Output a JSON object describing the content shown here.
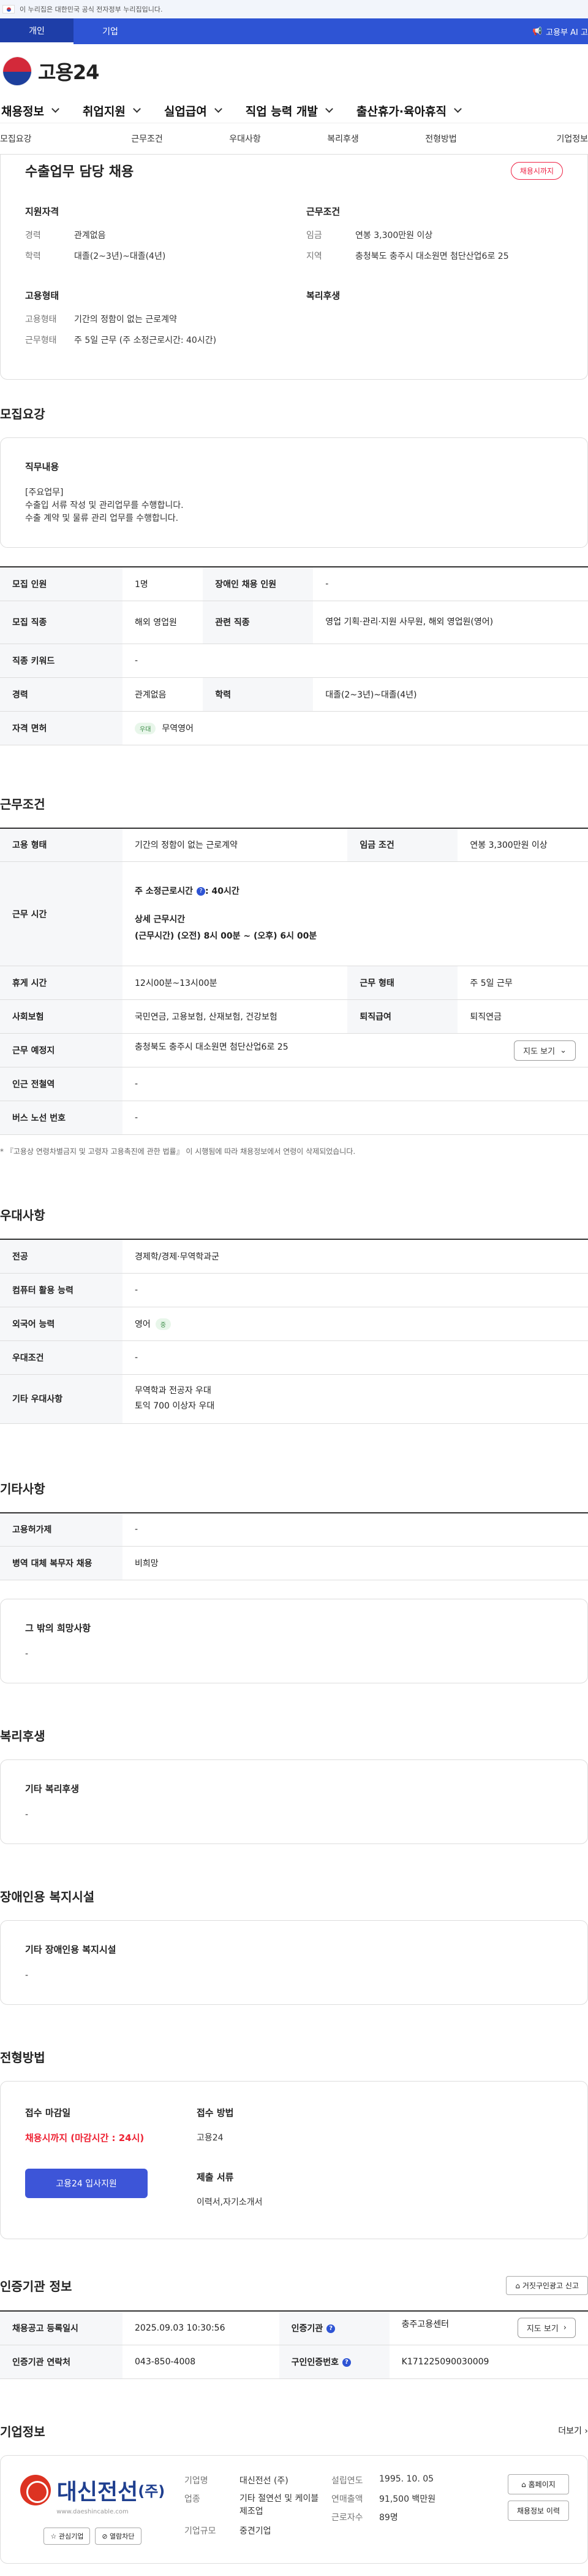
{
  "gov_banner": "이 누리집은 대한민국 공식 전자정부 누리집입니다.",
  "top_tabs": [
    {
      "label": "개인"
    },
    {
      "label": "기업"
    }
  ],
  "top_right": "고용부 AI 고",
  "logo": "고용24",
  "gnb": [
    {
      "label": "채용정보"
    },
    {
      "label": "취업지원"
    },
    {
      "label": "실업급여"
    },
    {
      "label": "직업 능력 개발"
    },
    {
      "label": "출산휴가·육아휴직"
    }
  ],
  "sub_tabs": [
    {
      "label": "모집요강"
    },
    {
      "label": "근무조건"
    },
    {
      "label": "우대사항"
    },
    {
      "label": "복리후생"
    },
    {
      "label": "전형방법"
    },
    {
      "label": "기업정보"
    }
  ],
  "hero": {
    "title": "수출업무 담당 채용",
    "badge": "채용시까지",
    "qualification": {
      "heading": "지원자격",
      "rows": [
        {
          "k": "경력",
          "v": "관계없음"
        },
        {
          "k": "학력",
          "v": "대졸(2~3년)~대졸(4년)"
        }
      ]
    },
    "conditions": {
      "heading": "근무조건",
      "rows": [
        {
          "k": "임금",
          "v": "연봉 3,300만원 이상"
        },
        {
          "k": "지역",
          "v": "충청북도 충주시 대소원면 첨단산업6로 25"
        }
      ]
    },
    "employment": {
      "heading": "고용형태",
      "rows": [
        {
          "k": "고용형태",
          "v": "기간의 정함이 없는 근로계약"
        },
        {
          "k": "근무형태",
          "v": "주 5일 근무 (주 소정근로시간: 40시간)"
        }
      ]
    },
    "welfare": {
      "heading": "복리후생"
    }
  },
  "recruit": {
    "title": "모집요강",
    "duty_heading": "직무내용",
    "duty_lines": [
      "[주요업무]",
      "수출입 서류 작성 및 관리업무를 수행합니다.",
      "수출 계약 및 물류 관리 업무를 수행합니다."
    ],
    "rows": [
      {
        "k1": "모집 인원",
        "v1": "1명",
        "k2": "장애인 채용 인원",
        "v2": "-"
      },
      {
        "k1": "모집 직종",
        "v1": "해외 영업원",
        "k2": "관련 직종",
        "v2": "영업 기획·관리·지원 사무원, 해외 영업원(영어)"
      },
      {
        "k1": "직종 키워드",
        "v1": "-"
      },
      {
        "k1": "경력",
        "v1": "관계없음",
        "k2": "학력",
        "v2": "대졸(2~3년)~대졸(4년)"
      },
      {
        "k1": "자격 면허",
        "badge": "우대",
        "v1": "무역영어"
      }
    ]
  },
  "work": {
    "title": "근무조건",
    "employment_type_k": "고용 형태",
    "employment_type_v": "기간의 정함이 없는 근로계약",
    "wage_k": "임금 조건",
    "wage_v": "연봉 3,300만원 이상",
    "hours_k": "근무 시간",
    "hours_main": "주 소정근로시간",
    "hours_main_v": ": 40시간",
    "hours_detail_title": "상세 근무시간",
    "hours_detail": "(근무시간) (오전) 8시 00분 ~ (오후) 6시 00분",
    "break_k": "휴게 시간",
    "break_v": "12시00분~13시00분",
    "shift_k": "근무 형태",
    "shift_v": "주 5일 근무",
    "insurance_k": "사회보험",
    "insurance_v": "국민연금, 고용보험, 산재보험, 건강보험",
    "severance_k": "퇴직급여",
    "severance_v": "퇴직연금",
    "place_k": "근무 예정지",
    "place_v": "충청북도 충주시 대소원면 첨단산업6로 25",
    "map_btn": "지도 보기",
    "subway_k": "인근 전철역",
    "subway_v": "-",
    "bus_k": "버스 노선 번호",
    "bus_v": "-",
    "note": "* 『고용상 연령차별금지 및 고령자 고용촉진에 관한 법률』 이 시행됨에 따라 채용정보에서 연령이 삭제되었습니다."
  },
  "prefer": {
    "title": "우대사항",
    "rows": [
      {
        "k": "전공",
        "v": "경제학/경제·무역학과군"
      },
      {
        "k": "컴퓨터 활용 능력",
        "v": "-"
      },
      {
        "k": "외국어 능력",
        "v": "영어",
        "badge": "중"
      },
      {
        "k": "우대조건",
        "v": "-"
      },
      {
        "k": "기타 우대사항",
        "lines": [
          "무역학과 전공자 우대",
          "토익 700 이상자 우대"
        ]
      }
    ]
  },
  "etc": {
    "title": "기타사항",
    "rows": [
      {
        "k": "고용허가제",
        "v": "-"
      },
      {
        "k": "병역 대체 복무자 채용",
        "v": "비희망"
      }
    ],
    "other_heading": "그 밖의 희망사항",
    "other_v": "-"
  },
  "welfare": {
    "title": "복리후생",
    "heading": "기타 복리후생",
    "v": "-"
  },
  "disability": {
    "title": "장애인용 복지시설",
    "heading": "기타 장애인용 복지시설",
    "v": "-"
  },
  "apply": {
    "title": "전형방법",
    "deadline_label": "접수 마감일",
    "deadline_v": "채용시까지 (마감시간 : 24시)",
    "btn": "고용24 입사지원",
    "method_label": "접수 방법",
    "method_v": "고용24",
    "docs_label": "제출 서류",
    "docs_v": "이력서,자기소개서"
  },
  "cert": {
    "title": "인증기관 정보",
    "report_btn": "거짓구인광고 신고",
    "rows": [
      {
        "k1": "채용공고 등록일시",
        "v1": "2025.09.03 10:30:56",
        "k2": "인증기관",
        "v2": "충주고용센터",
        "btn": "지도 보기"
      },
      {
        "k1": "인증기관 연락처",
        "v1": "043-850-4008",
        "k2": "구인인증번호",
        "v2": "K171225090030009"
      }
    ]
  },
  "company": {
    "title": "기업정보",
    "more": "더보기",
    "logo_text": "대신전선",
    "logo_suffix": "(주)",
    "url": "www.daeshincable.com",
    "interest_btn": "관심기업",
    "block_btn": "열람차단",
    "col1": [
      {
        "k": "기업명",
        "v": "대신전선 (주)"
      },
      {
        "k": "업종",
        "v": "기타 절연선 및 케이블 제조업"
      },
      {
        "k": "기업규모",
        "v": "중견기업"
      }
    ],
    "col2": [
      {
        "k": "설립연도",
        "v": "1995. 10. 05"
      },
      {
        "k": "연매출액",
        "v": "91,500 백만원"
      },
      {
        "k": "근로자수",
        "v": "89명"
      }
    ],
    "homepage_btn": "홈페이지",
    "history_btn": "채용정보 이력"
  }
}
